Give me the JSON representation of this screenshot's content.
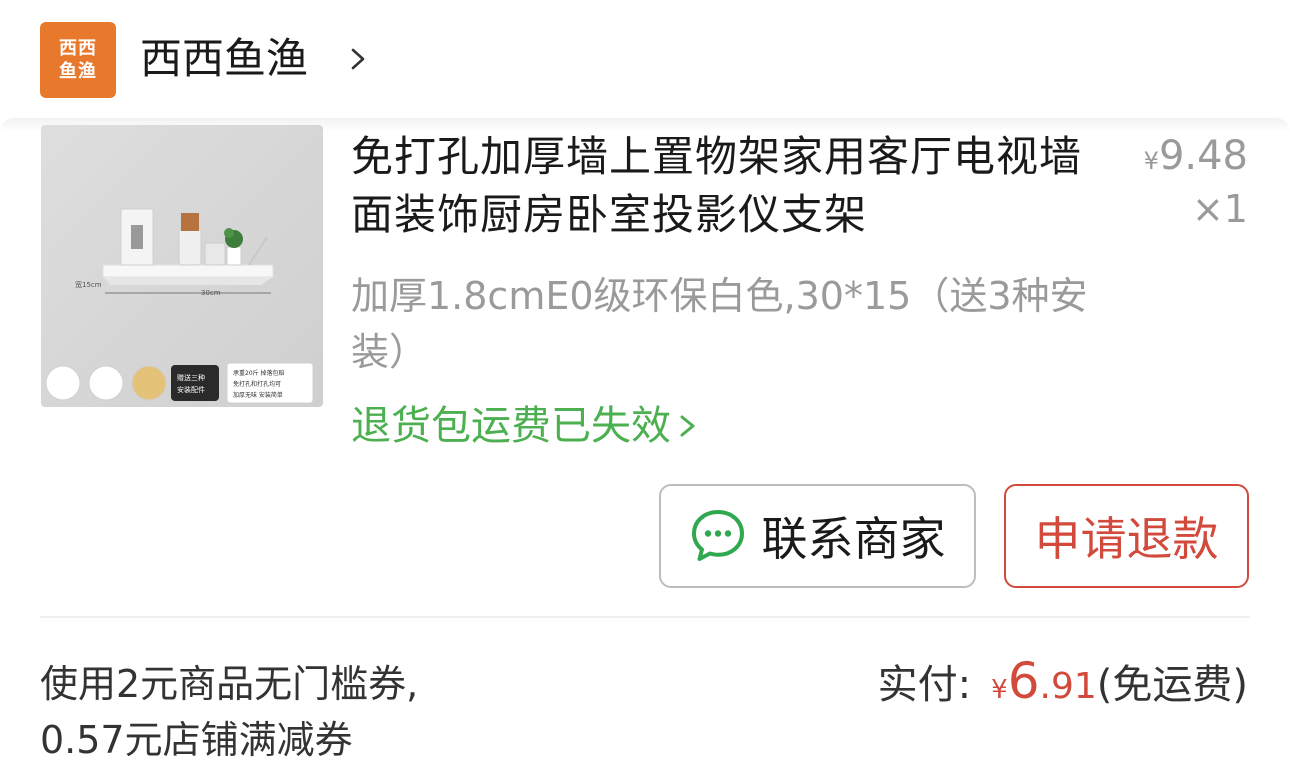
{
  "shop": {
    "logo_line1": "西西",
    "logo_line2": "鱼渔",
    "name": "西西鱼渔",
    "chevron_icon": "chevron-right-icon"
  },
  "product": {
    "title": "免打孔加厚墙上置物架家用客厅电视墙面装饰厨房卧室投影仪支架",
    "price_symbol": "¥",
    "price": "9.48",
    "quantity": "×1",
    "sku": "加厚1.8cmE0级环保白色,30*15（送3种安装）",
    "refund_note": "退货包运费已失效",
    "image_labels": {
      "width_label": "宽15cm",
      "length_label": "30cm",
      "badge1": "赠送三种",
      "badge2": "安装配件",
      "note1": "承重20斤 掉落包赔",
      "note2": "免打孔和打孔均可",
      "note3": "加厚无味 安装简单"
    }
  },
  "actions": {
    "contact_label": "联系商家",
    "contact_icon": "chat-bubble-icon",
    "refund_label": "申请退款"
  },
  "summary": {
    "coupon_text": "使用2元商品无门槛券,",
    "coupon_text_2": "0.57元店铺满减券",
    "paid_label": "实付:",
    "paid_symbol": "¥",
    "paid_int": "6",
    "paid_dec": ".91",
    "shipping_note": "(免运费)"
  },
  "colors": {
    "accent_red": "#d24a3c",
    "green": "#4caf50",
    "logo_orange": "#e8782c",
    "gray_text": "#9a9a9a"
  }
}
